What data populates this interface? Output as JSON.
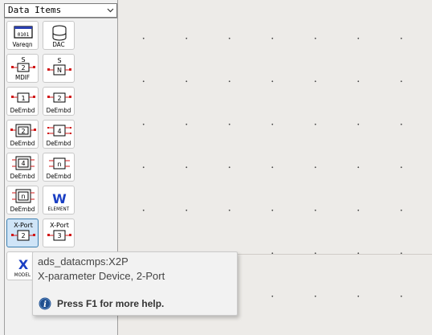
{
  "palette": {
    "category": "Data Items",
    "items": [
      {
        "label": "Vareqn",
        "icon": "vareqn-icon",
        "glyph": "0101"
      },
      {
        "label": "DAC",
        "icon": "database-icon"
      },
      {
        "label": "MDIF",
        "icon": "mdif-icon",
        "top": "S",
        "inner": "2"
      },
      {
        "label": "",
        "icon": "sn-param-icon",
        "top": "S",
        "inner": "N"
      },
      {
        "label": "DeEmbd",
        "icon": "deembed-1port-icon",
        "inner": "1"
      },
      {
        "label": "DeEmbd",
        "icon": "deembed-2port-icon",
        "inner": "2"
      },
      {
        "label": "DeEmbd",
        "icon": "deembed-2port-double-icon",
        "inner": "2"
      },
      {
        "label": "DeEmbd",
        "icon": "deembed-4port-icon",
        "inner": "4"
      },
      {
        "label": "DeEmbd",
        "icon": "deembed-4port-double-icon",
        "inner": "4"
      },
      {
        "label": "DeEmbd",
        "icon": "deembed-nport-icon",
        "inner": "n"
      },
      {
        "label": "DeEmbd",
        "icon": "deembed-nport-double-icon",
        "inner": "n"
      },
      {
        "label": "ELEMENT",
        "icon": "w-element-icon",
        "glyph": "W"
      },
      {
        "label": "",
        "icon": "xport-2-icon",
        "top": "X-Port",
        "inner": "2"
      },
      {
        "label": "",
        "icon": "xport-3-icon",
        "top": "X-Port",
        "inner": "3"
      },
      {
        "label": "MODEL",
        "icon": "x-model-icon",
        "glyph": "X"
      }
    ]
  },
  "tooltip": {
    "title": "ads_datacmps:X2P",
    "description": "X-parameter Device, 2-Port",
    "help": "Press F1 for more help."
  },
  "colors": {
    "selected_bg": "#cfe4f7",
    "selected_border": "#3c7fb1",
    "accent_blue": "#1a3fc4",
    "port_red": "#d01818"
  }
}
